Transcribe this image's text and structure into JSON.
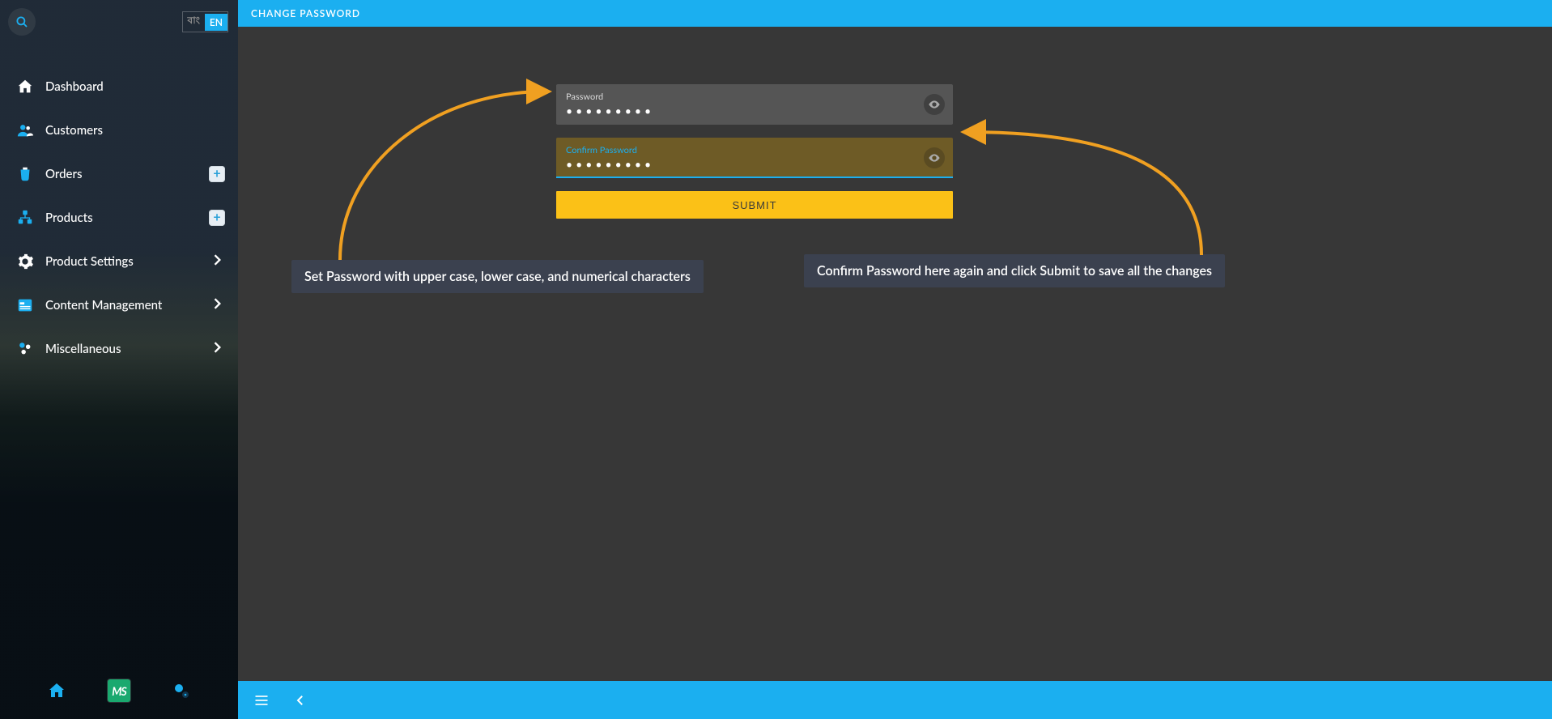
{
  "lang": {
    "inactive": "বাং",
    "active": "EN"
  },
  "sidebar": {
    "items": [
      {
        "label": "Dashboard"
      },
      {
        "label": "Customers"
      },
      {
        "label": "Orders"
      },
      {
        "label": "Products"
      },
      {
        "label": "Product Settings"
      },
      {
        "label": "Content Management"
      },
      {
        "label": "Miscellaneous"
      }
    ],
    "bottom_ms": "MS"
  },
  "header": {
    "title": "CHANGE PASSWORD"
  },
  "form": {
    "password": {
      "label": "Password",
      "value": "•••••••••"
    },
    "confirm": {
      "label": "Confirm Password",
      "value": "•••••••••"
    },
    "submit": "SUBMIT"
  },
  "callouts": {
    "set": "Set Password with upper case, lower case, and numerical characters",
    "confirm": "Confirm Password here again and click Submit to save all the changes"
  },
  "colors": {
    "accent": "#1baff0",
    "yellow": "#fbc117",
    "arrow": "#f0a021"
  }
}
